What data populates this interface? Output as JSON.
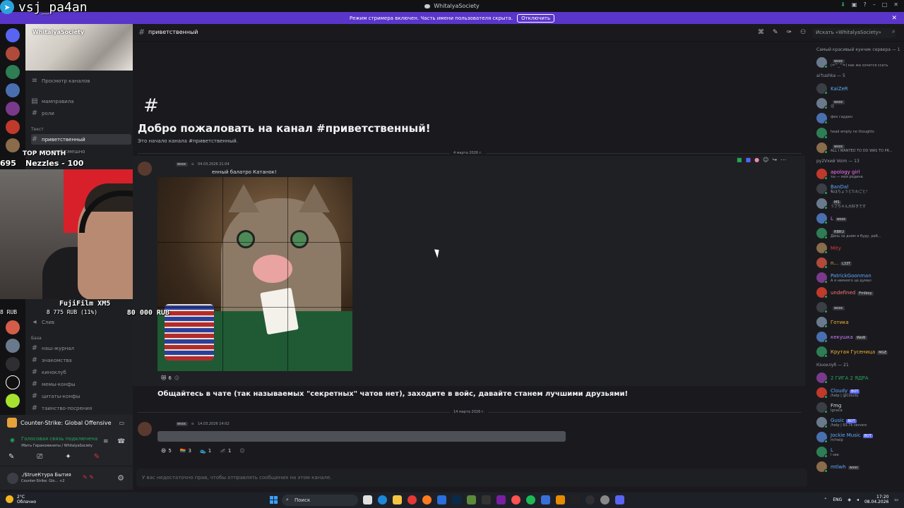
{
  "window": {
    "title": "WhitalyaSociety"
  },
  "overlay": {
    "telegram_name": "vsj_pa4an",
    "top_month_label": "TOP MONTH",
    "top_month_value": "Nezzles - 100",
    "top_month_num": "695",
    "cam_label": "FujiFilm XM5",
    "cam_amount_left": "8 775 RUB (11%)",
    "cam_amount_right": "80 000 RUB",
    "cam_rub": "8 RUB"
  },
  "banner": {
    "text": "Режим стримера включен. Часть имени пользователя скрыта.",
    "button": "Отключить"
  },
  "sidebar": {
    "server_name": "WhitalyaSociety",
    "browse_channels": "Просмотр каналов",
    "top_channels": [
      "мамправила",
      "роли"
    ],
    "category_text": "Текст",
    "active_channel": "приветственный",
    "partial_channel": "что-ещё-смешно",
    "voice_channel": "Слив",
    "category_base": "База",
    "base_channels": [
      "наш-журнал",
      "знакомства",
      "киноклуб",
      "мемы-конфы",
      "цитаты-конфы",
      "таинство-посрения"
    ]
  },
  "game": {
    "name": "Counter-Strike: Global Offensive"
  },
  "voice": {
    "status": "Голосовая связь подключена",
    "sub": "Убить Гиракоминиты / WhitalyaSociety"
  },
  "user": {
    "name": "./$trueКтура Бытия",
    "status": "Counter-Strike: Glo… +2"
  },
  "header": {
    "channel": "приветственный",
    "search_placeholder": "Искать «WhitalyaSociety»"
  },
  "welcome": {
    "hash": "#",
    "title": "Добро пожаловать на канал #приветственный!",
    "subtitle": "Это начало канала #приветственный."
  },
  "messages": {
    "date1": "4 марта 2026 г.",
    "msg1_tag": "wsoc",
    "msg1_time": "04.03.2026 21:04",
    "msg1_text": "енный балатро Катанок!",
    "msg1_reactions": [
      {
        "emoji": "😻",
        "count": "6"
      }
    ],
    "msg1_big": "Общайтесь в чате (так называемых \"секретных\" чатов нет), заходите в войс, давайте станем лучшими друзьями!",
    "date2": "14 марта 2026 г.",
    "msg2_tag": "wsoc",
    "msg2_time": "14.03.2026 14:02",
    "msg2_reactions": [
      {
        "emoji": "😆",
        "count": "5"
      },
      {
        "emoji": "🏳️‍🌈",
        "count": "3"
      },
      {
        "emoji": "👟",
        "count": "1"
      },
      {
        "emoji": "🦟",
        "count": "1"
      }
    ],
    "input_placeholder": "У вас недостаточно прав, чтобы отправлять сообщения на этом канале."
  },
  "members": {
    "groups": [
      {
        "title": "Самый красивый кунчик сервера — 1",
        "list": [
          {
            "name": "",
            "tag": "wsoc",
            "status": "(=^_^=) как же хочется ссать",
            "color": "#dbdee1"
          }
        ]
      },
      {
        "title": "ai'tushka — 5",
        "list": [
          {
            "name": "KaiZeR",
            "tag": "",
            "status": "",
            "color": "#5fa8ff"
          },
          {
            "name": "",
            "tag": "wsoc",
            "status": "😊",
            "color": "#dbdee1"
          },
          {
            "name": "",
            "tag": "",
            "status": "фек гадден",
            "color": "#dbdee1"
          },
          {
            "name": "",
            "tag": "",
            "status": "head empty no thoughts",
            "color": "#dbdee1"
          },
          {
            "name": "",
            "tag": "wsoc",
            "status": "ALL I WANTED TO DO WAS TO PR...",
            "color": "#dbdee1"
          }
        ]
      },
      {
        "title": "ру2Vхий Voim — 13",
        "list": [
          {
            "name": "apology girl",
            "tag": "",
            "status": "ты — моя родина",
            "color": "#ff73fa"
          },
          {
            "name": "BanDal",
            "tag": "",
            "status": "私はちょうどたわごと!",
            "color": "#5fa8ff"
          },
          {
            "name": "",
            "tag": "MS",
            "status": "うさちゃん大好きです",
            "color": "#da373c"
          },
          {
            "name": "L",
            "tag": "wsoc",
            "status": "",
            "color": "#c77dff"
          },
          {
            "name": "",
            "tag": "RBRU",
            "status": "День за днем я буду, раб...",
            "color": "#da373c"
          },
          {
            "name": "Mity",
            "tag": "",
            "status": "",
            "color": "#da373c"
          },
          {
            "name": "n...",
            "tag": "L33T",
            "status": "",
            "color": "#f0b232"
          },
          {
            "name": "PatrickGoonman",
            "tag": "",
            "status": "А я немного це думал",
            "color": "#5fa8ff"
          },
          {
            "name": "undefined",
            "tag": "Fmlboy",
            "status": "",
            "color": "#ff7575"
          },
          {
            "name": "",
            "tag": "wsoc",
            "status": "",
            "color": "#ff7575"
          },
          {
            "name": "Готика",
            "tag": "",
            "status": "",
            "color": "#f0b232"
          },
          {
            "name": "кекушка",
            "tag": "WeW",
            "status": "",
            "color": "#c77dff"
          },
          {
            "name": "Крутая Гусеница",
            "tag": "MGE",
            "status": "",
            "color": "#f0b232"
          }
        ]
      },
      {
        "title": "Кіноклуб — 21",
        "list": [
          {
            "name": "2 ГИГА 2 ЯДРА",
            "tag": "",
            "status": "",
            "color": "#23a55a"
          },
          {
            "name": "Cloudy",
            "tag": "BOT",
            "status": "/help | @Cloudy",
            "color": "#5fa8ff"
          },
          {
            "name": "Fmg",
            "tag": "",
            "status": "Ignaca",
            "color": "#dbdee1"
          },
          {
            "name": "Gusic",
            "tag": "BOT",
            "status": "/help | 93.7k servers",
            "color": "#5fa8ff"
          },
          {
            "name": "Jockie Music",
            "tag": "BOT",
            "status": "m!help",
            "color": "#5fa8ff"
          },
          {
            "name": "L",
            "tag": "",
            "status": "I see",
            "color": "#5fa8ff"
          },
          {
            "name": "mtlwh",
            "tag": "wsoc",
            "status": "",
            "color": "#5fa8ff"
          }
        ]
      }
    ]
  },
  "taskbar": {
    "weather_temp": "2°C",
    "weather_desc": "Облачно",
    "search": "Поиск",
    "lang": "ENG",
    "time": "17:20",
    "date": "08.04.2026"
  }
}
